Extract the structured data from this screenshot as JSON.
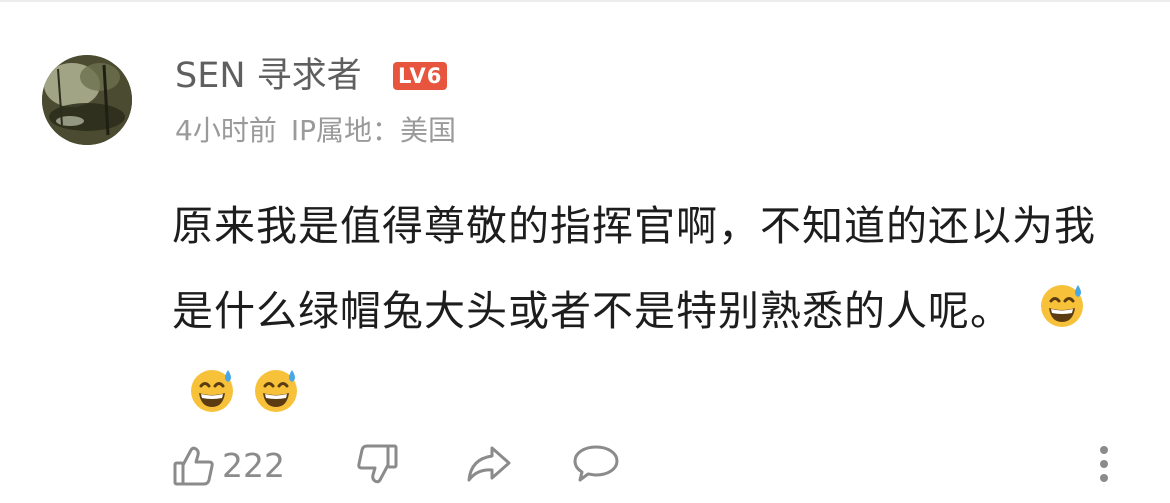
{
  "comment": {
    "username": "SEN 寻求者",
    "level": "LV6",
    "time": "4小时前",
    "ip_location": "IP属地：美国",
    "text": "原来我是值得尊敬的指挥官啊，不知道的还以为我是什么绿帽兔大头或者不是特别熟悉的人呢。",
    "emojis": [
      "grinning-sweat-emoji",
      "grinning-sweat-emoji",
      "grinning-sweat-emoji"
    ],
    "like_count": "222"
  },
  "icons": {
    "like": "thumbs-up-icon",
    "dislike": "thumbs-down-icon",
    "share": "share-arrow-icon",
    "reply": "speech-bubble-icon",
    "more": "more-vertical-icon"
  },
  "colors": {
    "level_badge": "#e8553e",
    "username": "#5f5f5f",
    "meta": "#9a9a9a",
    "text": "#1d1d1d",
    "icon": "#8b8b8b"
  }
}
